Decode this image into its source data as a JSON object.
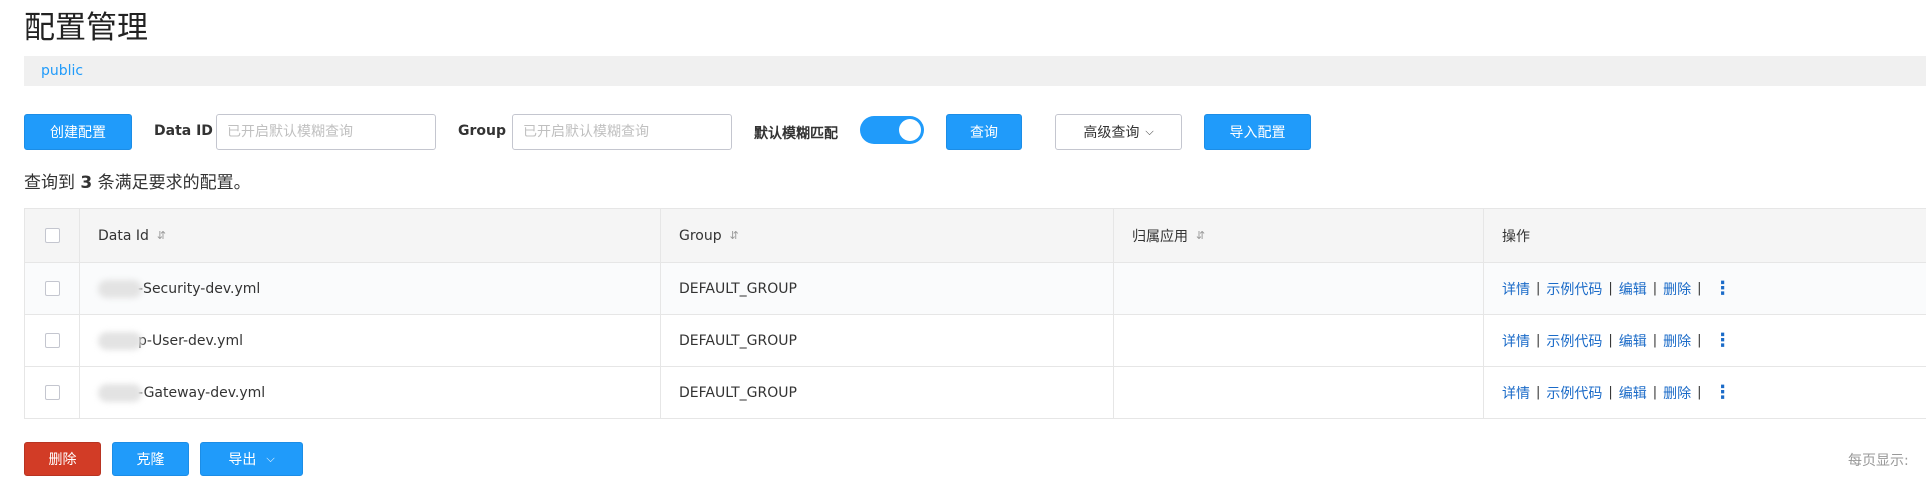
{
  "page": {
    "title": "配置管理"
  },
  "namespace": {
    "active": "public"
  },
  "toolbar": {
    "create_label": "创建配置",
    "data_id_label": "Data ID",
    "data_id_placeholder": "已开启默认模糊查询",
    "group_label": "Group",
    "group_placeholder": "已开启默认模糊查询",
    "fuzzy_label": "默认模糊匹配",
    "fuzzy_enabled": true,
    "query_label": "查询",
    "advanced_label": "高级查询",
    "import_label": "导入配置"
  },
  "result": {
    "prefix": "查询到 ",
    "count": "3",
    "suffix": " 条满足要求的配置。"
  },
  "table": {
    "columns": [
      "Data Id",
      "Group",
      "归属应用",
      "操作"
    ],
    "rows": [
      {
        "data_id": "-Security-dev.yml",
        "group": "DEFAULT_GROUP",
        "app": ""
      },
      {
        "data_id": "p-User-dev.yml",
        "group": "DEFAULT_GROUP",
        "app": ""
      },
      {
        "data_id": "-Gateway-dev.yml",
        "group": "DEFAULT_GROUP",
        "app": ""
      }
    ],
    "actions": [
      "详情",
      "示例代码",
      "编辑",
      "删除"
    ]
  },
  "footer": {
    "delete_label": "删除",
    "clone_label": "克隆",
    "export_label": "导出",
    "page_size_label": "每页显示:"
  },
  "colors": {
    "primary": "#209bfa",
    "danger": "#d23c26",
    "link": "#1b6bc8"
  }
}
